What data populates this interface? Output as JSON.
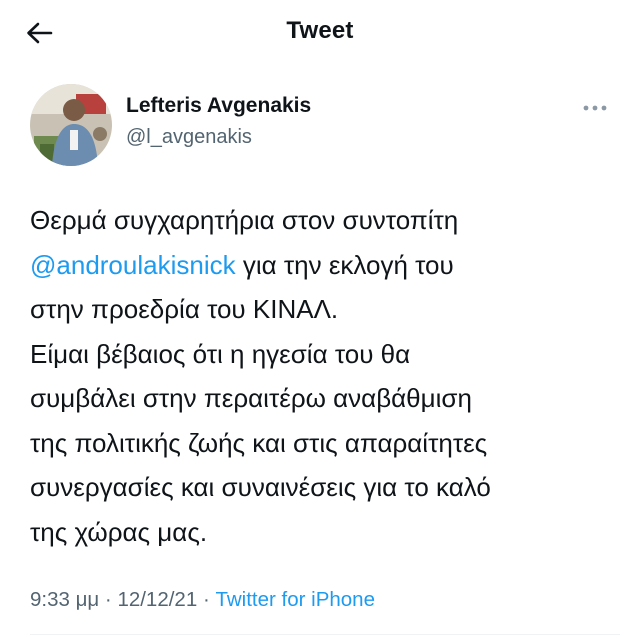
{
  "header": {
    "title": "Tweet",
    "back_icon": "arrow-left-icon"
  },
  "author": {
    "name": "Lefteris Avgenakis",
    "handle": "@l_avgenakis",
    "avatar_icon": "avatar-photo",
    "more_icon": "more-dots-icon"
  },
  "tweet": {
    "lines": [
      {
        "before": "Θερμά συγχαρητήρια στον συντοπίτη",
        "mention": "",
        "after": ""
      },
      {
        "before": "",
        "mention": "@androulakisnick",
        "after": " για την εκλογή του"
      },
      {
        "before": "στην προεδρία του ΚΙΝΑΛ.",
        "mention": "",
        "after": ""
      },
      {
        "before": "Είμαι βέβαιος ότι η ηγεσία του θα",
        "mention": "",
        "after": ""
      },
      {
        "before": "συμβάλει στην περαιτέρω αναβάθμιση",
        "mention": "",
        "after": ""
      },
      {
        "before": "της πολιτικής ζωής και στις απαραίτητες",
        "mention": "",
        "after": ""
      },
      {
        "before": "συνεργασίες και συναινέσεις για το καλό",
        "mention": "",
        "after": ""
      },
      {
        "before": "της χώρας μας.",
        "mention": "",
        "after": ""
      }
    ]
  },
  "meta": {
    "time": "9:33 μμ",
    "separator": " · ",
    "date": "12/12/21",
    "source": "Twitter for iPhone"
  },
  "colors": {
    "link": "#1d9bf0",
    "secondary_text": "#536471",
    "primary_text": "#0f1419"
  }
}
